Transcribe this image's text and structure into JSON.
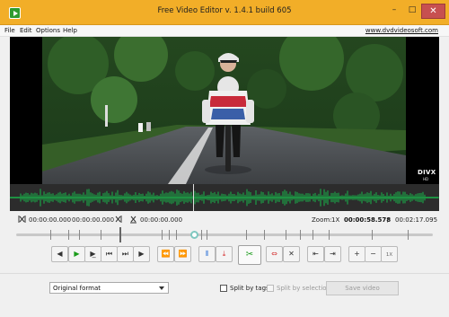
{
  "window": {
    "title": "Free Video Editor v. 1.4.1 build 605",
    "controls": {
      "minimize": "–",
      "maximize": "□",
      "close": "✕"
    }
  },
  "menu": {
    "items": [
      "File",
      "Edit",
      "Options",
      "Help"
    ],
    "site_link": "www.dvdvideosoft.com"
  },
  "video": {
    "watermark": "DIVX",
    "watermark_sub": "HD"
  },
  "markers": {
    "start_time": "00:00:00.000",
    "end_time": "00:00:00.000",
    "third_time": "00:00:00.000",
    "zoom_label": "Zoom:",
    "zoom_value": "1X",
    "current_time": "00:00:58.578",
    "separator": "/",
    "total_time": "00:02:17.095"
  },
  "timeline": {
    "position_fraction": 0.427
  },
  "controls": {
    "zoom_reset_label": "1X",
    "icons": [
      "back-icon",
      "play-icon",
      "play-selection-icon",
      "prev-frame-icon",
      "next-frame-icon",
      "forward-icon",
      "go-start-icon",
      "go-end-icon",
      "split-icon",
      "save-marker-icon",
      "cut-icon",
      "add-marker-icon",
      "remove-marker-icon",
      "prev-marker-icon",
      "next-marker-icon",
      "zoom-in-icon",
      "zoom-out-icon"
    ]
  },
  "bottom": {
    "format_value": "Original format",
    "split_by_tags": "Split by tags",
    "split_by_selections": "Split by selections",
    "save_button": "Save video"
  },
  "colors": {
    "title_bar": "#f2ae28",
    "waveform": "#19b34a",
    "play_green": "#1a9b1a"
  }
}
